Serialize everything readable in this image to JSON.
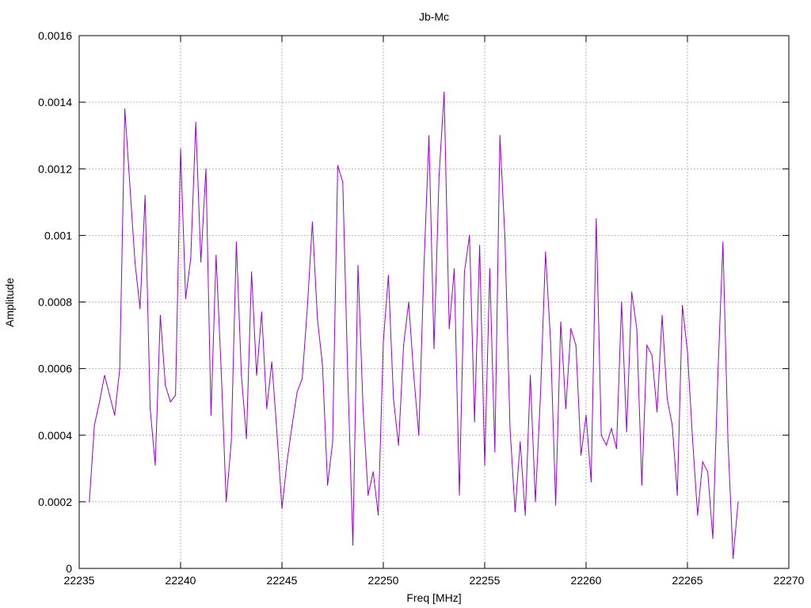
{
  "chart_data": {
    "type": "line",
    "title": "Jb-Mc",
    "xlabel": "Freq [MHz]",
    "ylabel": "Amplitude",
    "xlim": [
      22235,
      22270
    ],
    "ylim": [
      0,
      0.0016
    ],
    "x_ticks": [
      22235,
      22240,
      22245,
      22250,
      22255,
      22260,
      22265,
      22270
    ],
    "x_tick_labels": [
      "22235",
      "22240",
      "22245",
      "22250",
      "22255",
      "22260",
      "22265",
      "22270"
    ],
    "y_ticks": [
      0,
      0.0002,
      0.0004,
      0.0006,
      0.0008,
      0.001,
      0.0012,
      0.0014,
      0.0016
    ],
    "y_tick_labels": [
      "0",
      "0.0002",
      "0.0004",
      "0.0006",
      "0.0008",
      "0.001",
      "0.0012",
      "0.0014",
      "0.0016"
    ],
    "grid": true,
    "series_color": "#9400d3",
    "series": [
      {
        "x": [
          22235.5,
          22235.75,
          22236.0,
          22236.25,
          22236.5,
          22236.75,
          22237.0,
          22237.25,
          22237.5,
          22237.75,
          22238.0,
          22238.25,
          22238.5,
          22238.75,
          22239.0,
          22239.25,
          22239.5,
          22239.75,
          22240.0,
          22240.25,
          22240.5,
          22240.75,
          22241.0,
          22241.25,
          22241.5,
          22241.75,
          22242.0,
          22242.25,
          22242.5,
          22242.75,
          22243.0,
          22243.25,
          22243.5,
          22243.75,
          22244.0,
          22244.25,
          22244.5,
          22244.75,
          22245.0,
          22245.25,
          22245.5,
          22245.75,
          22246.0,
          22246.25,
          22246.5,
          22246.75,
          22247.0,
          22247.25,
          22247.5,
          22247.75,
          22248.0,
          22248.25,
          22248.5,
          22248.75,
          22249.0,
          22249.25,
          22249.5,
          22249.75,
          22250.0,
          22250.25,
          22250.5,
          22250.75,
          22251.0,
          22251.25,
          22251.5,
          22251.75,
          22252.0,
          22252.25,
          22252.5,
          22252.75,
          22253.0,
          22253.25,
          22253.5,
          22253.75,
          22254.0,
          22254.25,
          22254.5,
          22254.75,
          22255.0,
          22255.25,
          22255.5,
          22255.75,
          22256.0,
          22256.25,
          22256.5,
          22256.75,
          22257.0,
          22257.25,
          22257.5,
          22257.75,
          22258.0,
          22258.25,
          22258.5,
          22258.75,
          22259.0,
          22259.25,
          22259.5,
          22259.75,
          22260.0,
          22260.25,
          22260.5,
          22260.75,
          22261.0,
          22261.25,
          22261.5,
          22261.75,
          22262.0,
          22262.25,
          22262.5,
          22262.75,
          22263.0,
          22263.25,
          22263.5,
          22263.75,
          22264.0,
          22264.25,
          22264.5,
          22264.75,
          22265.0,
          22265.25,
          22265.5,
          22265.75,
          22266.0,
          22266.25,
          22266.5,
          22266.75,
          22267.0,
          22267.25,
          22267.5
        ],
        "y": [
          0.0002,
          0.00043,
          0.0005,
          0.00058,
          0.00052,
          0.00046,
          0.0006,
          0.00138,
          0.00115,
          0.00092,
          0.00078,
          0.00112,
          0.00048,
          0.00031,
          0.00076,
          0.00055,
          0.0005,
          0.00052,
          0.00126,
          0.00081,
          0.00093,
          0.00134,
          0.00092,
          0.0012,
          0.00046,
          0.00094,
          0.0006,
          0.0002,
          0.00038,
          0.00098,
          0.00058,
          0.00039,
          0.00089,
          0.00058,
          0.00077,
          0.00048,
          0.00062,
          0.00041,
          0.00018,
          0.00032,
          0.00043,
          0.00053,
          0.00057,
          0.00078,
          0.00104,
          0.00075,
          0.00061,
          0.00025,
          0.00038,
          0.00121,
          0.00116,
          0.00057,
          7e-05,
          0.00091,
          0.00048,
          0.00022,
          0.00029,
          0.00016,
          0.00068,
          0.00088,
          0.00051,
          0.00037,
          0.00067,
          0.0008,
          0.00058,
          0.0004,
          0.0009,
          0.0013,
          0.00066,
          0.00118,
          0.00143,
          0.00072,
          0.0009,
          0.00022,
          0.00089,
          0.001,
          0.00044,
          0.00097,
          0.00031,
          0.0009,
          0.00035,
          0.0013,
          0.00099,
          0.00042,
          0.00017,
          0.00038,
          0.00016,
          0.00058,
          0.0002,
          0.00052,
          0.00095,
          0.00068,
          0.00019,
          0.00074,
          0.00048,
          0.00072,
          0.00067,
          0.00034,
          0.00046,
          0.00026,
          0.00105,
          0.0004,
          0.00037,
          0.00042,
          0.00036,
          0.0008,
          0.00041,
          0.00083,
          0.00072,
          0.00025,
          0.00067,
          0.00064,
          0.00047,
          0.00076,
          0.00051,
          0.00043,
          0.00022,
          0.00079,
          0.00065,
          0.00039,
          0.00016,
          0.00032,
          0.00029,
          9e-05,
          0.00058,
          0.00098,
          0.00038,
          3e-05,
          0.0002
        ]
      }
    ]
  }
}
